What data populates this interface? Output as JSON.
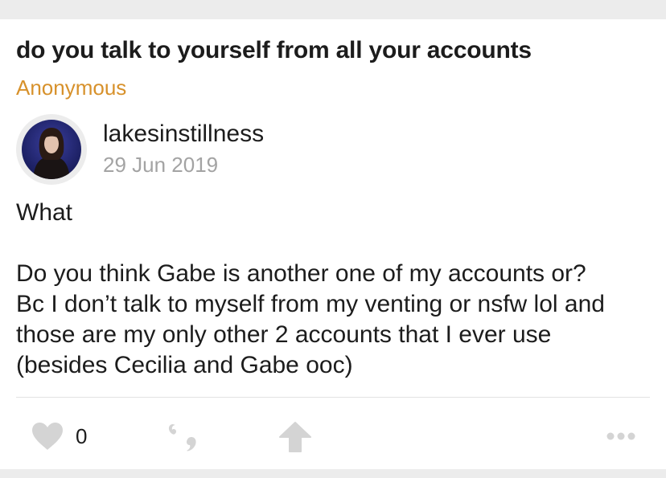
{
  "question": {
    "text": "do you talk to yourself from all your accounts",
    "asker": "Anonymous"
  },
  "answer": {
    "username": "lakesinstillness",
    "date": "29 Jun 2019",
    "paragraphs": [
      [
        "What"
      ],
      [
        "Do you think Gabe is another one of my accounts or?",
        "Bc I don’t talk to myself from my venting or nsfw lol and",
        "those are my only other 2 accounts that I ever use",
        "(besides Cecilia and Gabe ooc)"
      ]
    ]
  },
  "actions": {
    "like_count": "0",
    "icons": [
      "heart-icon",
      "quote-icon",
      "share-arrow-icon",
      "more-dots-icon"
    ]
  },
  "colors": {
    "accent": "#d7912b",
    "text": "#1c1c1c",
    "muted": "#a3a3a3",
    "icon": "#d4d4d4"
  }
}
